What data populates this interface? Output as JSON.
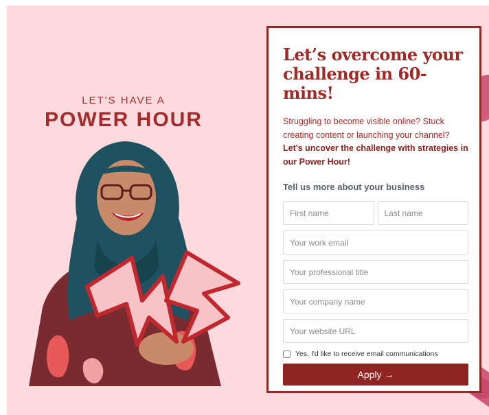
{
  "hero": {
    "kicker": "LET'S HAVE A",
    "title": "POWER HOUR"
  },
  "card": {
    "heading": "Let’s overcome your challenge in 60-mins!",
    "intro_plain": "Struggling to become visible online? Stuck creating content or launching your channel? ",
    "intro_bold": "Let's uncover the challenge with strategies in our Power Hour!",
    "section_label": "Tell us more about your business"
  },
  "form": {
    "first_name_placeholder": "First name",
    "last_name_placeholder": "Last name",
    "email_placeholder": "Your work email",
    "title_placeholder": "Your professional title",
    "company_placeholder": "Your company name",
    "website_placeholder": "Your website URL",
    "consent_label": "Yes, I'd like to receive email communications",
    "consent_checked": false,
    "submit_label": "Apply →"
  },
  "colors": {
    "background": "#fcdadd",
    "brand": "#a52a2a",
    "button": "#8f2520",
    "accent_stripe": "#c9446b"
  },
  "icons": {
    "submit_arrow": "arrow-right-icon",
    "illustration": "lightning-bolt-icon"
  }
}
